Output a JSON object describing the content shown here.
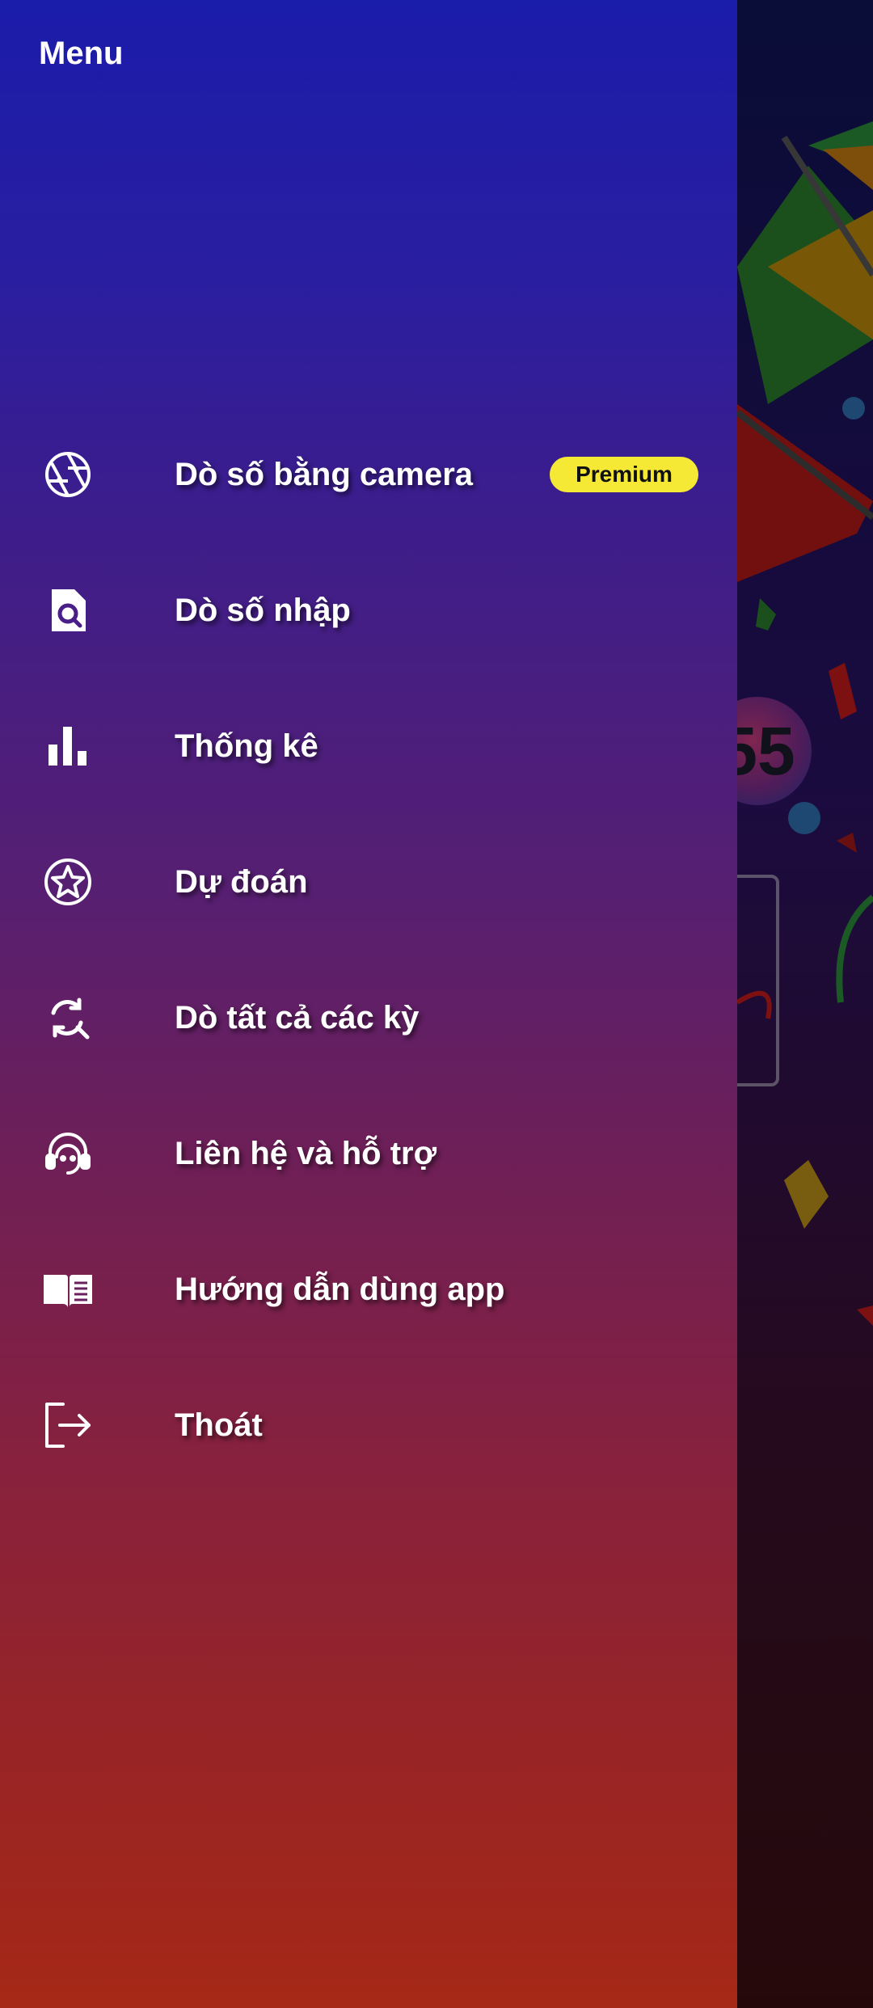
{
  "drawer": {
    "title": "Menu",
    "items": [
      {
        "label": "Dò số bằng camera",
        "icon": "camera-aperture-icon",
        "badge": "Premium"
      },
      {
        "label": "Dò số nhập",
        "icon": "search-document-icon"
      },
      {
        "label": "Thống kê",
        "icon": "bar-chart-icon"
      },
      {
        "label": "Dự đoán",
        "icon": "star-circle-icon"
      },
      {
        "label": "Dò tất cả các kỳ",
        "icon": "refresh-search-icon"
      },
      {
        "label": "Liên hệ và hỗ trợ",
        "icon": "headset-support-icon"
      },
      {
        "label": "Hướng dẫn dùng app",
        "icon": "book-icon"
      },
      {
        "label": "Thoát",
        "icon": "logout-icon"
      }
    ]
  },
  "background": {
    "ball_number": "55"
  },
  "colors": {
    "badge": "#f5e935",
    "drawer_top": "#1a1caa",
    "drawer_bottom": "#a62816",
    "text": "#ffffff"
  }
}
